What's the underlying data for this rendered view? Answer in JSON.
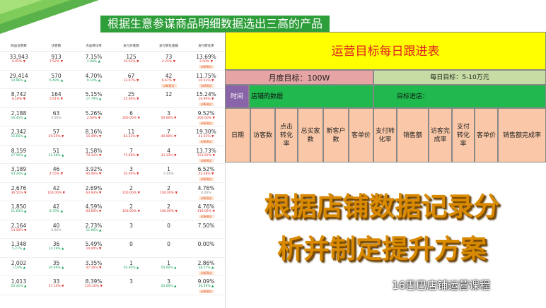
{
  "banner": {
    "title": "根据生意参谋商品明细数据选出三高的产品"
  },
  "stats_table": {
    "headers": [
      "商品访客数",
      "访客数",
      "点击转化率",
      "支付买家数",
      "支付转化金额",
      "支付转化率"
    ],
    "rows": [
      [
        {
          "v": "33,943",
          "c": "0.05%",
          "d": "up"
        },
        {
          "v": "913",
          "c": "7.92%",
          "d": "up"
        },
        {
          "v": "7.15%",
          "c": "2.98%",
          "d": "down"
        },
        {
          "v": "125",
          "c": "10.62%",
          "d": "up"
        },
        {
          "v": "73",
          "c": "4.25%",
          "d": "up"
        },
        {
          "v": "13.69%",
          "c": "2.50%",
          "d": "up",
          "b": "诊断建议"
        }
      ],
      [
        {
          "v": "29,414",
          "c": "14.96%",
          "d": "down"
        },
        {
          "v": "570",
          "c": "6.49%",
          "d": "down"
        },
        {
          "v": "4.70%",
          "c": "9.10%",
          "d": "down"
        },
        {
          "v": "67",
          "c": "13.67%",
          "d": "up"
        },
        {
          "v": "42",
          "c": "6.67%",
          "d": "up",
          "b": "诊断建议"
        },
        {
          "v": "11.75%",
          "c": "10.51%",
          "d": "up",
          "b": "诊断建议"
        }
      ],
      [
        {
          "v": "8,742",
          "c": "8.18%",
          "d": "up"
        },
        {
          "v": "164",
          "c": "5.61%",
          "d": "up"
        },
        {
          "v": "5.15%",
          "c": "17.79%",
          "d": "down"
        },
        {
          "v": "25",
          "c": "25.00%",
          "d": "up"
        },
        {
          "v": "12",
          "c": "",
          "d": "neutral"
        },
        {
          "v": "15.24%",
          "c": "16.90%",
          "d": "up",
          "b": "诊断建议"
        }
      ],
      [
        {
          "v": "2,188",
          "c": "16.45%",
          "d": "down"
        },
        {
          "v": "63",
          "c": "0.00%",
          "d": "neutral"
        },
        {
          "v": "5.26%",
          "c": "2.69%",
          "d": "up"
        },
        {
          "v": "6",
          "c": "200.00%",
          "d": "up"
        },
        {
          "v": "3",
          "c": "50.00%",
          "d": "up"
        },
        {
          "v": "9.52%",
          "c": "200.00%",
          "d": "up",
          "b": "诊断建议"
        }
      ],
      [
        {
          "v": "2,342",
          "c": "15.65%",
          "d": "down"
        },
        {
          "v": "57",
          "c": "29.55%",
          "d": "up"
        },
        {
          "v": "8.16%",
          "c": "15.49%",
          "d": "up"
        },
        {
          "v": "11",
          "c": "83.33%",
          "d": "up"
        },
        {
          "v": "7",
          "c": "40.00%",
          "d": "up"
        },
        {
          "v": "19.30%",
          "c": "41.52%",
          "d": "up",
          "b": "诊断建议"
        }
      ],
      [
        {
          "v": "8,159",
          "c": "27.56%",
          "d": "down"
        },
        {
          "v": "51",
          "c": "31.08%",
          "d": "down"
        },
        {
          "v": "1.58%",
          "c": "70.12%",
          "d": "up"
        },
        {
          "v": "7",
          "c": "75.00%",
          "d": "up"
        },
        {
          "v": "4",
          "c": "33.33%",
          "d": "up"
        },
        {
          "v": "13.73%",
          "c": "153.92%",
          "d": "up",
          "b": "诊断建议"
        }
      ],
      [
        {
          "v": "3,189",
          "c": "43.26%",
          "d": "down"
        },
        {
          "v": "46",
          "c": "4.55%",
          "d": "up"
        },
        {
          "v": "3.92%",
          "c": "95.06%",
          "d": "up"
        },
        {
          "v": "3",
          "c": "50.00%",
          "d": "up"
        },
        {
          "v": "1",
          "c": "0.00%",
          "d": "neutral"
        },
        {
          "v": "6.52%",
          "c": "43.48%",
          "d": "up",
          "b": "诊断建议"
        }
      ],
      [
        {
          "v": "2,676",
          "c": "36.51%",
          "d": "up"
        },
        {
          "v": "42",
          "c": "100.00%",
          "d": "up"
        },
        {
          "v": "2.69%",
          "c": "63.93%",
          "d": "up"
        },
        {
          "v": "2",
          "c": "100.00%",
          "d": "up"
        },
        {
          "v": "2",
          "c": "100.00%",
          "d": "up"
        },
        {
          "v": "4.76%",
          "c": "0.00%",
          "d": "neutral",
          "b": "诊断建议"
        }
      ],
      [
        {
          "v": "1,850",
          "c": "11.63%",
          "d": "down"
        },
        {
          "v": "42",
          "c": "8.70%",
          "d": "down"
        },
        {
          "v": "4.59%",
          "c": "63.69%",
          "d": "up"
        },
        {
          "v": "2",
          "c": "100.00%",
          "d": "up"
        },
        {
          "v": "2",
          "c": "100.00%",
          "d": "up"
        },
        {
          "v": "4.76%",
          "c": "119.05%",
          "d": "up",
          "b": "诊断建议"
        }
      ],
      [
        {
          "v": "2,164",
          "c": "14.50%",
          "d": "up"
        },
        {
          "v": "40",
          "c": "0.00%",
          "d": "neutral"
        },
        {
          "v": "2.73%",
          "c": "11.66%",
          "d": "down"
        },
        {
          "v": "3",
          "c": "",
          "d": "neutral"
        },
        {
          "v": "0",
          "c": "",
          "d": "neutral"
        },
        {
          "v": "7.50%",
          "c": "",
          "d": "neutral"
        }
      ],
      [
        {
          "v": "1,348",
          "c": "5.27%",
          "d": "down"
        },
        {
          "v": "36",
          "c": "14.29%",
          "d": "down"
        },
        {
          "v": "5.49%",
          "c": "10.00%",
          "d": "up"
        },
        {
          "v": "0",
          "c": "",
          "d": "neutral"
        },
        {
          "v": "0",
          "c": "",
          "d": "neutral"
        },
        {
          "v": "0.00%",
          "c": "",
          "d": "neutral"
        }
      ],
      [
        {
          "v": "2,002",
          "c": "7.10%",
          "d": "down"
        },
        {
          "v": "35",
          "c": "20.69%",
          "d": "down"
        },
        {
          "v": "3.35%",
          "c": "47.16%",
          "d": "up"
        },
        {
          "v": "1",
          "c": "50.00%",
          "d": "down"
        },
        {
          "v": "1",
          "c": "50.00%",
          "d": "down"
        },
        {
          "v": "2.86%",
          "c": "58.57%",
          "d": "down",
          "b": "诊断建议"
        }
      ],
      [
        {
          "v": "1,013",
          "c": "25.41%",
          "d": "down"
        },
        {
          "v": "33",
          "c": "57.14%",
          "d": "up"
        },
        {
          "v": "8.39%",
          "c": "135.10%",
          "d": "up"
        },
        {
          "v": "3",
          "c": "",
          "d": "neutral"
        },
        {
          "v": "3",
          "c": "50.00%",
          "d": "down"
        },
        {
          "v": "9.09%",
          "c": "36.36%",
          "d": "down",
          "b": "诊断建议"
        }
      ]
    ]
  },
  "tracker": {
    "title": "运营目标每日跟进表",
    "monthly_target": "月度目标：100W",
    "daily_target": "每日目标：5-10万元",
    "time_label": "时间",
    "store_data_label": "店铺的数据",
    "target_progress_label": "目标进店：",
    "columns": [
      "日期",
      "访客数",
      "点击转化率",
      "总买家数",
      "新客户数",
      "客单价",
      "支付转化率",
      "销售额",
      "访客完成率",
      "支付转化率",
      "客单价",
      "销售额完成率"
    ]
  },
  "overlay": {
    "line1": "根据店铺数据记录分",
    "line2": "析并制定提升方案"
  },
  "watermark": {
    "text": "16巴巴店铺运营课程"
  },
  "colors": {
    "banner": "#2e9e3a",
    "tracker_title_bg": "#ffff00",
    "tracker_title_text": "#e02020",
    "overlay_text": "#d98a00"
  }
}
